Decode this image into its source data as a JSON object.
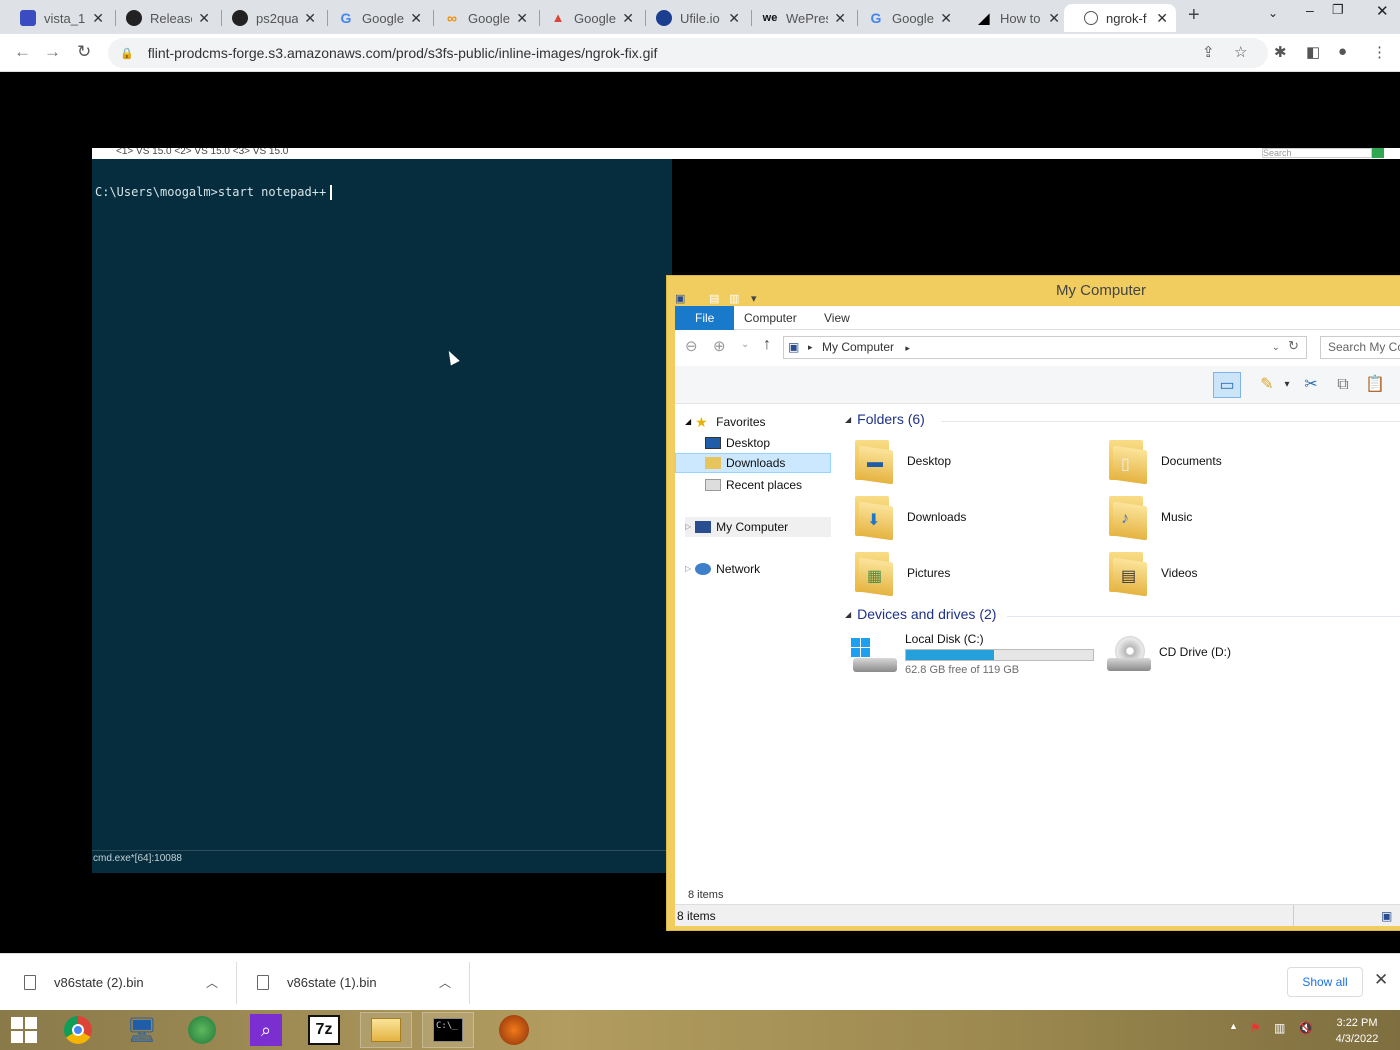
{
  "browser": {
    "tabs": [
      {
        "title": "vista_1...",
        "favicon_color": "#3b4cc0"
      },
      {
        "title": "Release",
        "favicon_color": "#222222"
      },
      {
        "title": "ps2qual",
        "favicon_color": "#222222"
      },
      {
        "title": "Google",
        "favicon_color": "#4285f4"
      },
      {
        "title": "Google",
        "favicon_color": "#f28b00"
      },
      {
        "title": "Google",
        "favicon_color": "#db4437"
      },
      {
        "title": "Ufile.io",
        "favicon_color": "#1a3f8f"
      },
      {
        "title": "WePres",
        "favicon_color": "#111111"
      },
      {
        "title": "Google",
        "favicon_color": "#4285f4"
      },
      {
        "title": "How to",
        "favicon_color": "#000000"
      },
      {
        "title": "ngrok-f",
        "favicon_color": "#555555"
      }
    ],
    "url": "flint-prodcms-forge.s3.amazonaws.com/prod/s3fs-public/inline-images/ngrok-fix.gif"
  },
  "console": {
    "tabs_text": "<1> VS 15.0   <2> VS 15.0   <3> VS 15.0",
    "search_placeholder": "Search",
    "prompt": "C:\\Users\\moogalm>start notepad++",
    "status": "cmd.exe*[64]:10088"
  },
  "explorer": {
    "title": "My Computer",
    "ribbon_tabs": [
      "File",
      "Computer",
      "View"
    ],
    "address": "My Computer",
    "search_placeholder": "Search My Co",
    "nav": {
      "favorites": "Favorites",
      "desktop": "Desktop",
      "downloads": "Downloads",
      "recent": "Recent places",
      "computer": "My Computer",
      "network": "Network"
    },
    "folders_header": "Folders (6)",
    "folders": [
      "Desktop",
      "Documents",
      "Downloads",
      "Music",
      "Pictures",
      "Videos"
    ],
    "drives_header": "Devices and drives (2)",
    "local_disk": {
      "name": "Local Disk (C:)",
      "free": "62.8 GB free of 119 GB",
      "used_fraction": 0.47
    },
    "cd_drive": "CD Drive (D:)",
    "items_count": "8 items",
    "status_items": "8 items"
  },
  "downloads": {
    "items": [
      "v86state (2).bin",
      "v86state (1).bin"
    ],
    "show_all": "Show all"
  },
  "taskbar": {
    "time": "3:22 PM",
    "date": "4/3/2022"
  },
  "colors": {
    "console_bg": "#052d3e",
    "explorer_frame": "#f0cd5e",
    "accent": "#1979ca"
  }
}
